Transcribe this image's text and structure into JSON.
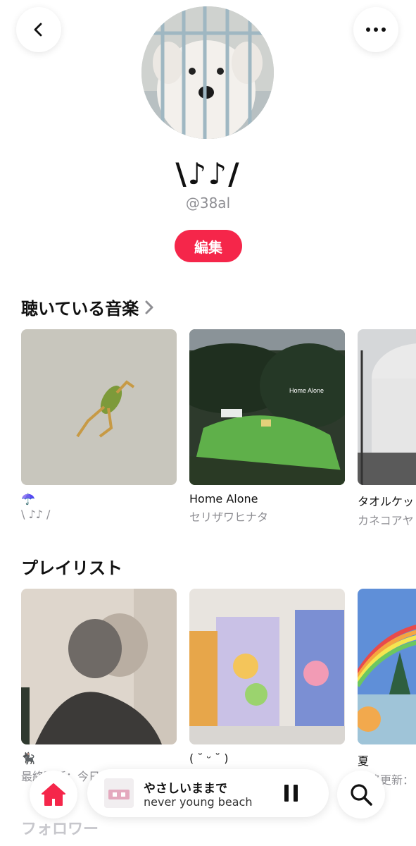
{
  "profile": {
    "display_name": "\\♪♪/",
    "handle": "@38al",
    "edit_label": "編集"
  },
  "listening": {
    "title": "聴いている音楽",
    "items": [
      {
        "title": "☂️",
        "artist": "\\ ♪♪ /"
      },
      {
        "title": "Home Alone",
        "artist": "セリザワヒナタ",
        "cover_text": "Home Alone"
      },
      {
        "title": "タオルケッ",
        "artist": "カネコアヤ"
      }
    ]
  },
  "playlists": {
    "title": "プレイリスト",
    "items": [
      {
        "title": "🐈‍⬛",
        "meta": "最終更新：今日"
      },
      {
        "title": "( ˘ ᵕ ˘ )",
        "meta": ""
      },
      {
        "title": "夏",
        "meta": "最終更新："
      }
    ]
  },
  "now_playing": {
    "title": "やさしいままで",
    "artist": "never young beach"
  },
  "followers_label": "フォロワー",
  "icons": [
    "back-icon",
    "more-icon",
    "chevron-right-icon",
    "home-icon",
    "pause-icon",
    "search-icon"
  ],
  "colors": {
    "accent": "#f5264a"
  }
}
